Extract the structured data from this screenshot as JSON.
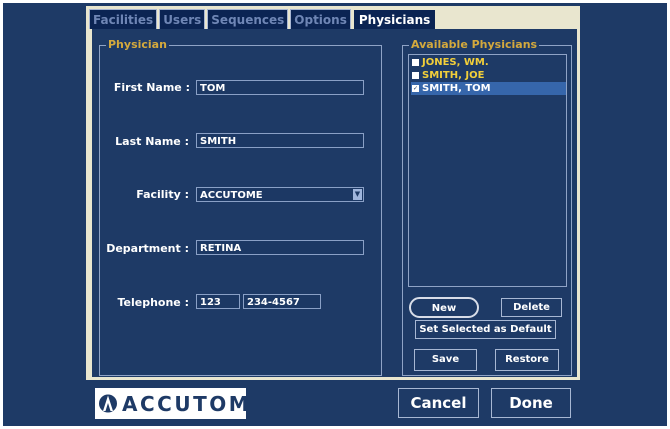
{
  "tabs": [
    {
      "label": "Facilities"
    },
    {
      "label": "Users"
    },
    {
      "label": "Sequences"
    },
    {
      "label": "Options"
    },
    {
      "label": "Physicians",
      "active": true
    }
  ],
  "physician_group": {
    "legend": "Physician"
  },
  "form": {
    "first_name": {
      "label": "First Name :",
      "value": "TOM"
    },
    "last_name": {
      "label": "Last Name :",
      "value": "SMITH"
    },
    "facility": {
      "label": "Facility :",
      "value": "ACCUTOME"
    },
    "department": {
      "label": "Department :",
      "value": "RETINA"
    },
    "telephone": {
      "label": "Telephone :",
      "area_code": "123",
      "number": "234-4567"
    }
  },
  "available": {
    "legend": "Available Physicians",
    "items": [
      {
        "label": "JONES, WM.",
        "selected": false
      },
      {
        "label": "SMITH, JOE",
        "selected": false
      },
      {
        "label": "SMITH, TOM",
        "selected": true
      }
    ]
  },
  "buttons": {
    "new": "New",
    "delete": "Delete",
    "set_default": "Set Selected as Default",
    "save": "Save",
    "restore": "Restore",
    "cancel": "Cancel",
    "done": "Done"
  },
  "logo": {
    "text": "ACCUTOME"
  },
  "colors": {
    "background": "#1e3a66",
    "frame": "#e9e6cf",
    "legend": "#d4a93d",
    "list_text": "#f2cf3a",
    "selection": "#3666ab"
  }
}
